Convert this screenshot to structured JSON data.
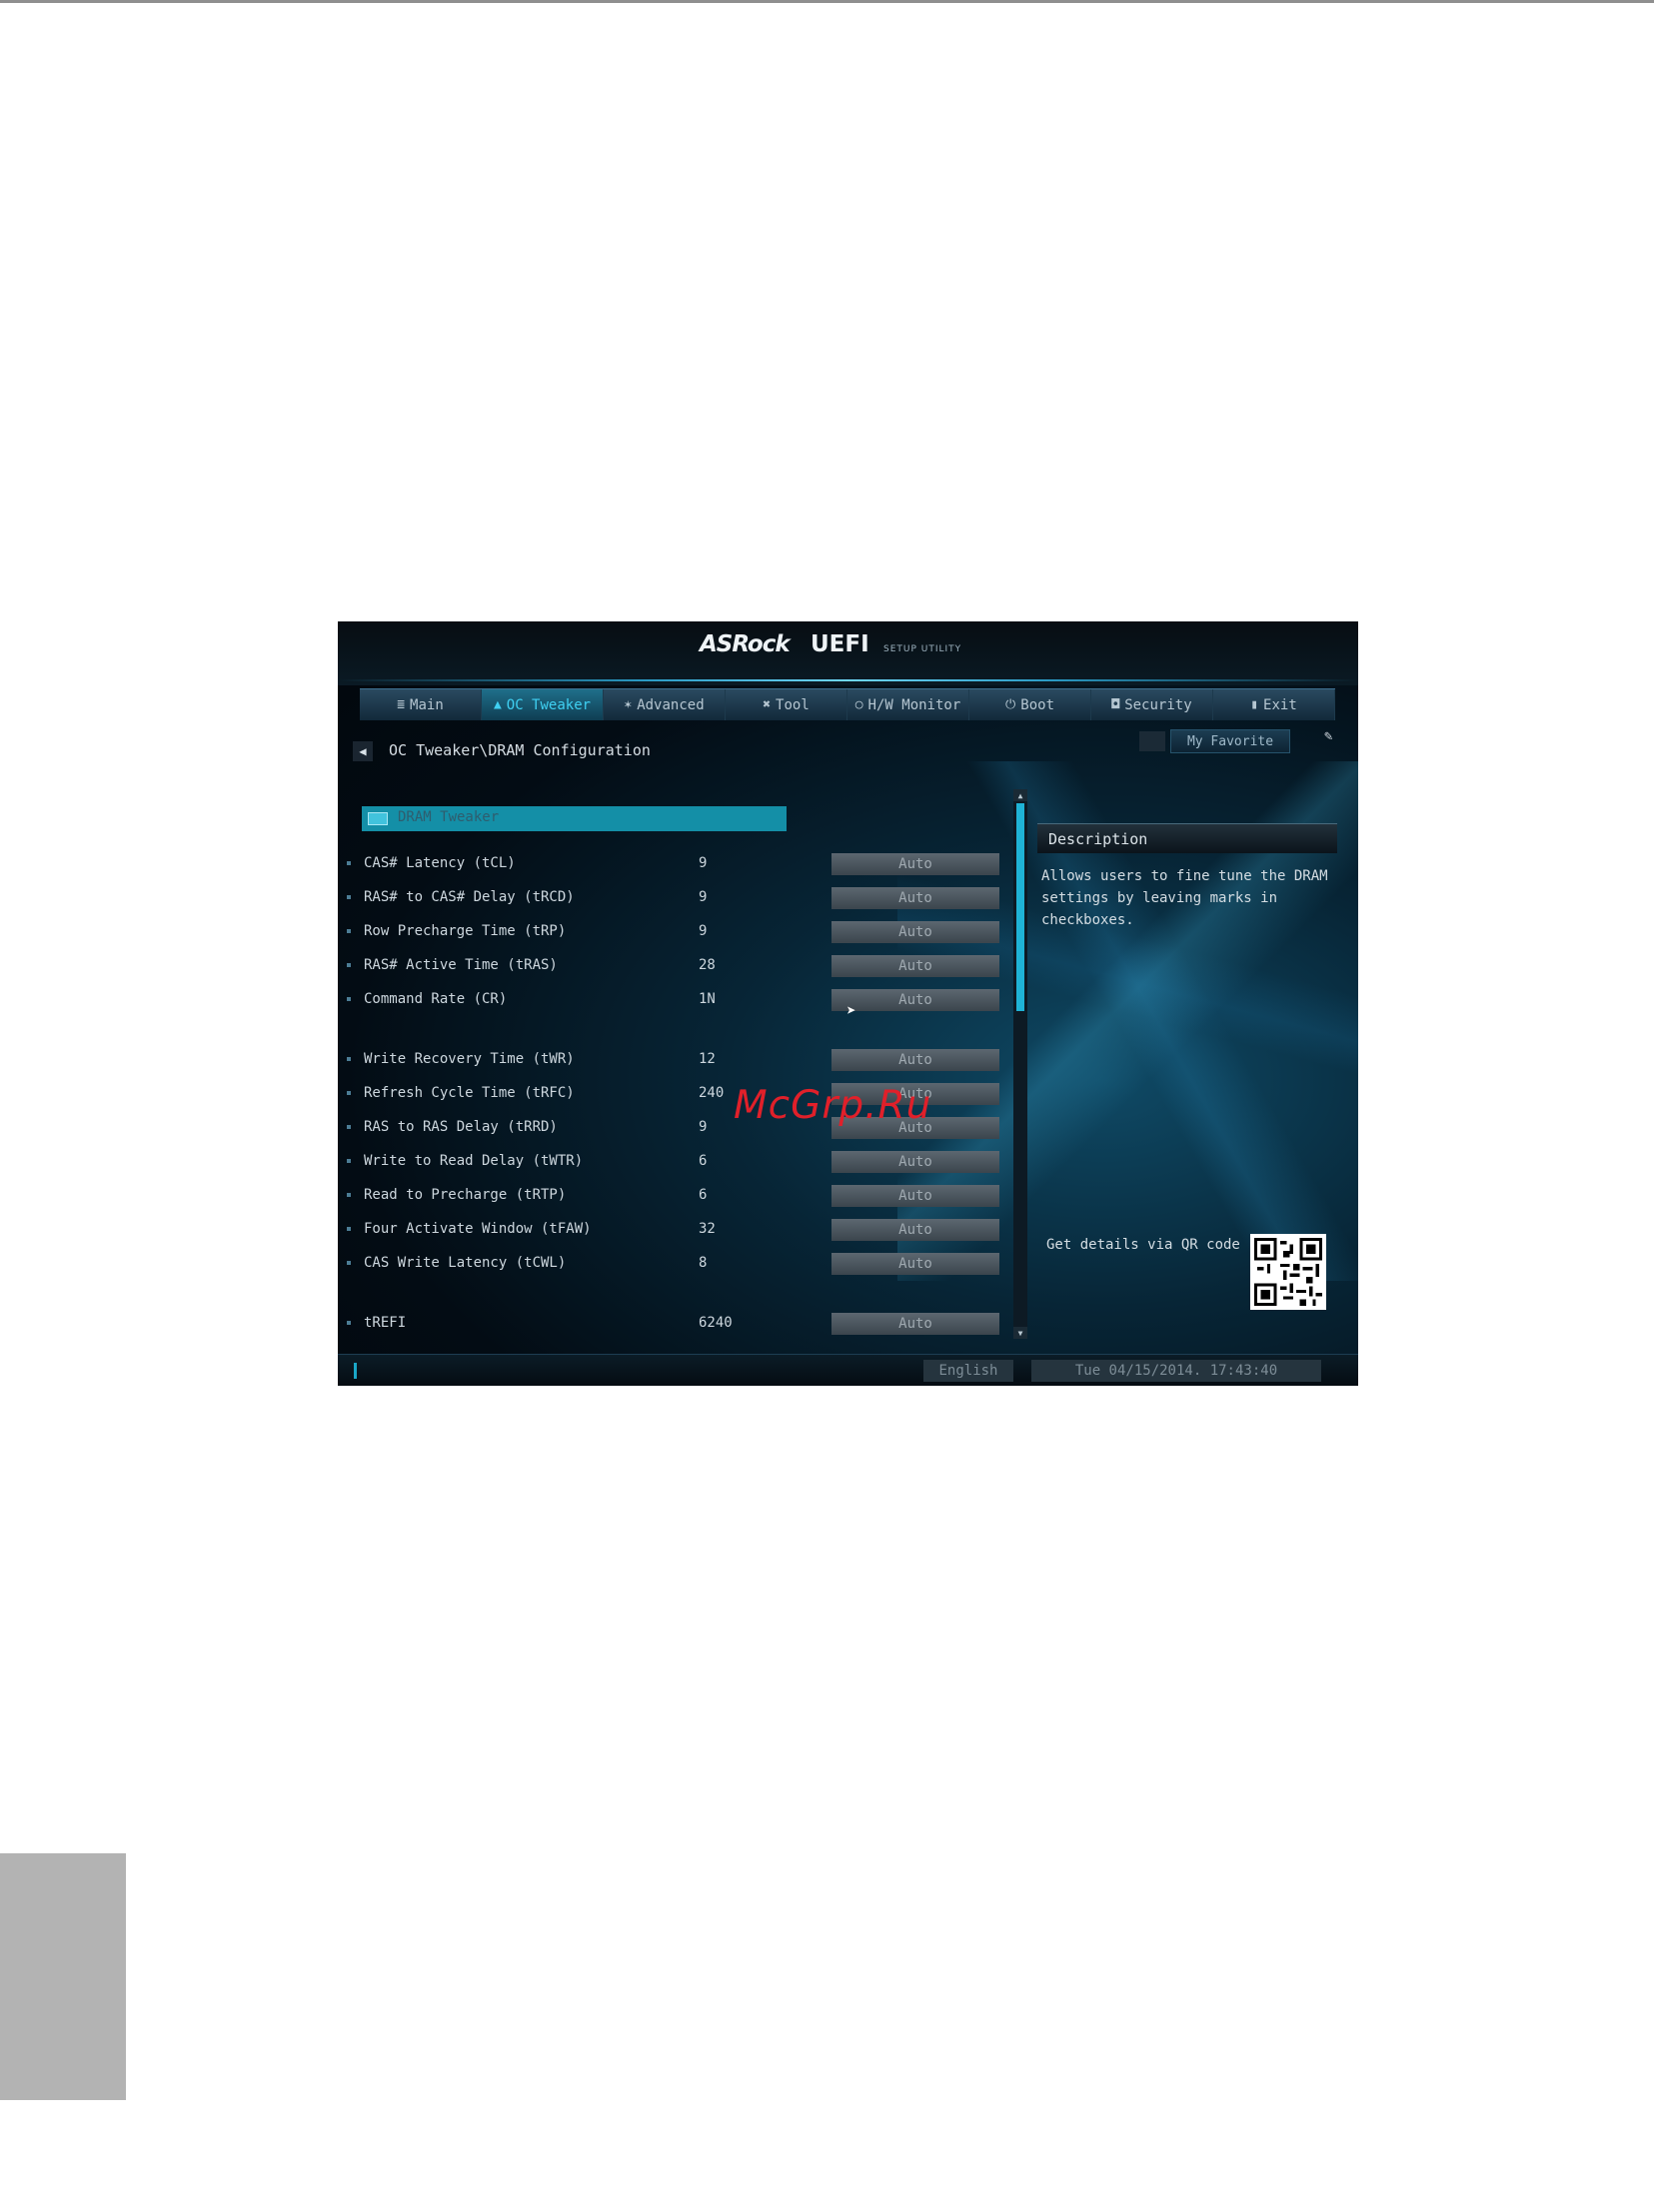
{
  "header": {
    "brand": "ASRock",
    "product": "UEFI",
    "subtitle": "SETUP UTILITY"
  },
  "tabs": [
    {
      "label": "Main",
      "icon": "list-icon",
      "active": false
    },
    {
      "label": "OC Tweaker",
      "icon": "flame-icon",
      "active": true
    },
    {
      "label": "Advanced",
      "icon": "star-icon",
      "active": false
    },
    {
      "label": "Tool",
      "icon": "tool-icon",
      "active": false
    },
    {
      "label": "H/W Monitor",
      "icon": "circle-icon",
      "active": false
    },
    {
      "label": "Boot",
      "icon": "power-icon",
      "active": false
    },
    {
      "label": "Security",
      "icon": "shield-icon",
      "active": false
    },
    {
      "label": "Exit",
      "icon": "door-icon",
      "active": false
    }
  ],
  "breadcrumb": "OC Tweaker\\DRAM Configuration",
  "favorite_label": "My Favorite",
  "section": {
    "title": "DRAM Tweaker"
  },
  "settings": [
    {
      "label": "CAS# Latency (tCL)",
      "value": "9",
      "option": "Auto"
    },
    {
      "label": "RAS# to CAS# Delay (tRCD)",
      "value": "9",
      "option": "Auto"
    },
    {
      "label": "Row Precharge Time (tRP)",
      "value": "9",
      "option": "Auto"
    },
    {
      "label": "RAS# Active Time (tRAS)",
      "value": "28",
      "option": "Auto"
    },
    {
      "label": "Command Rate (CR)",
      "value": "1N",
      "option": "Auto"
    },
    {
      "label": "Write Recovery Time (tWR)",
      "value": "12",
      "option": "Auto"
    },
    {
      "label": "Refresh Cycle Time (tRFC)",
      "value": "240",
      "option": "Auto"
    },
    {
      "label": "RAS to RAS Delay (tRRD)",
      "value": "9",
      "option": "Auto"
    },
    {
      "label": "Write to Read Delay (tWTR)",
      "value": "6",
      "option": "Auto"
    },
    {
      "label": "Read to Precharge (tRTP)",
      "value": "6",
      "option": "Auto"
    },
    {
      "label": "Four Activate Window (tFAW)",
      "value": "32",
      "option": "Auto"
    },
    {
      "label": "CAS Write Latency (tCWL)",
      "value": "8",
      "option": "Auto"
    },
    {
      "label": "tREFI",
      "value": "6240",
      "option": "Auto"
    }
  ],
  "description": {
    "title": "Description",
    "text": "Allows users to fine tune the DRAM settings by leaving marks in checkboxes."
  },
  "qr_label": "Get details via QR code",
  "footer": {
    "language": "English",
    "datetime": "Tue 04/15/2014. 17:43:40"
  },
  "watermark": "McGrp.Ru",
  "colors": {
    "accent": "#1fb3d6",
    "active_tab": "#3fd0f2",
    "watermark": "#e0202a"
  }
}
